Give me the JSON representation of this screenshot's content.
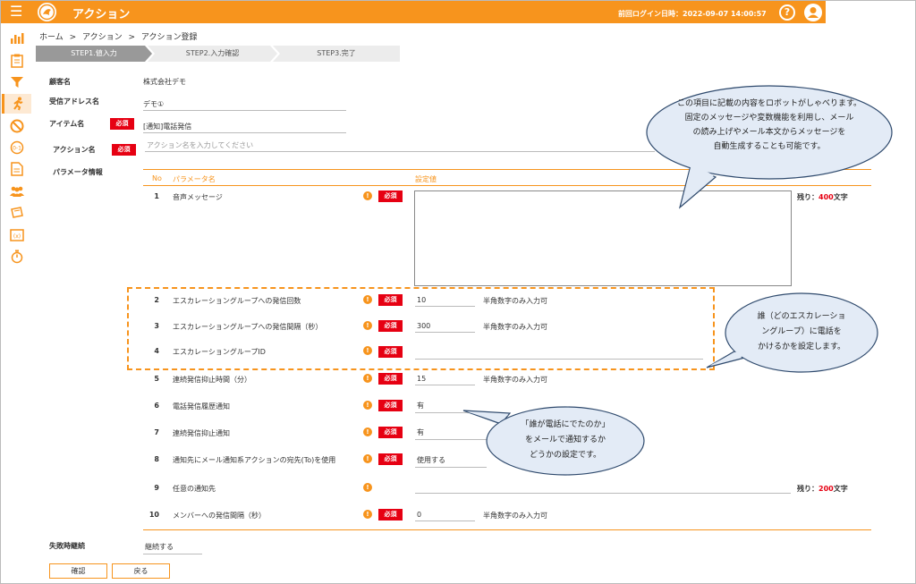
{
  "header": {
    "title": "アクション",
    "last_login": "前回ログイン日時：2022-09-07 14:00:57",
    "help_label": "?"
  },
  "breadcrumb": [
    "ホーム",
    ">",
    "アクション",
    ">",
    "アクション登録"
  ],
  "steps": [
    "STEP1.値入力",
    "STEP2.入力確認",
    "STEP3.完了"
  ],
  "form": {
    "customer_label": "顧客名",
    "customer_value": "株式会社デモ",
    "address_label": "受信アドレス名",
    "address_value": "デモ①",
    "item_label": "アイテム名",
    "item_value": "[通知]電話発信",
    "action_label": "アクション名",
    "action_placeholder": "アクション名を入力してください",
    "params_label": "パラメータ情報",
    "required": "必須",
    "col_no": "No",
    "col_name": "パラメータ名",
    "col_value": "設定値",
    "failure_label": "失敗時継続",
    "failure_value": "継続する"
  },
  "params": [
    {
      "no": "1",
      "name": "音声メッセージ",
      "value": "",
      "hint": "",
      "remain_prefix": "残り：",
      "remain_num": "400",
      "remain_suffix": "文字"
    },
    {
      "no": "2",
      "name": "エスカレーショングループへの発信回数",
      "value": "10",
      "hint": "半角数字のみ入力可"
    },
    {
      "no": "3",
      "name": "エスカレーショングループへの発信間隔（秒）",
      "value": "300",
      "hint": "半角数字のみ入力可"
    },
    {
      "no": "4",
      "name": "エスカレーショングループID",
      "value": "",
      "hint": ""
    },
    {
      "no": "5",
      "name": "連続発信抑止時間（分）",
      "value": "15",
      "hint": "半角数字のみ入力可"
    },
    {
      "no": "6",
      "name": "電話発信履歴通知",
      "value": "有",
      "hint": ""
    },
    {
      "no": "7",
      "name": "連続発信抑止通知",
      "value": "有",
      "hint": ""
    },
    {
      "no": "8",
      "name": "通知先にメール通知系アクションの宛先(To)を使用",
      "value": "使用する",
      "hint": ""
    },
    {
      "no": "9",
      "name": "任意の通知先",
      "value": "",
      "hint": "",
      "remain_prefix": "残り：",
      "remain_num": "200",
      "remain_suffix": "文字"
    },
    {
      "no": "10",
      "name": "メンバーへの発信間隔（秒）",
      "value": "0",
      "hint": "半角数字のみ入力可"
    }
  ],
  "buttons": {
    "confirm": "確認",
    "back": "戻る"
  },
  "balloons": {
    "b1": [
      "この項目に記載の内容をロボットがしゃべります。",
      "固定のメッセージや変数機能を利用し、メール",
      "の読み上げやメール本文からメッセージを",
      "自動生成することも可能です。"
    ],
    "b2": [
      "誰（どのエスカレーショ",
      "ングループ）に電話を",
      "かけるかを設定します。"
    ],
    "b3": [
      "「誰が電話にでたのか」",
      "をメールで通知するか",
      "どうかの設定です。"
    ]
  },
  "sidebar_icons": [
    "bar-chart-icon",
    "clipboard-icon",
    "filter-icon",
    "running-person-icon",
    "prohibit-icon",
    "variable-icon",
    "document-icon",
    "group-icon",
    "ticket-icon",
    "formula-icon",
    "stopwatch-icon"
  ],
  "colors": {
    "accent": "#f7941d",
    "required": "#e60012"
  }
}
